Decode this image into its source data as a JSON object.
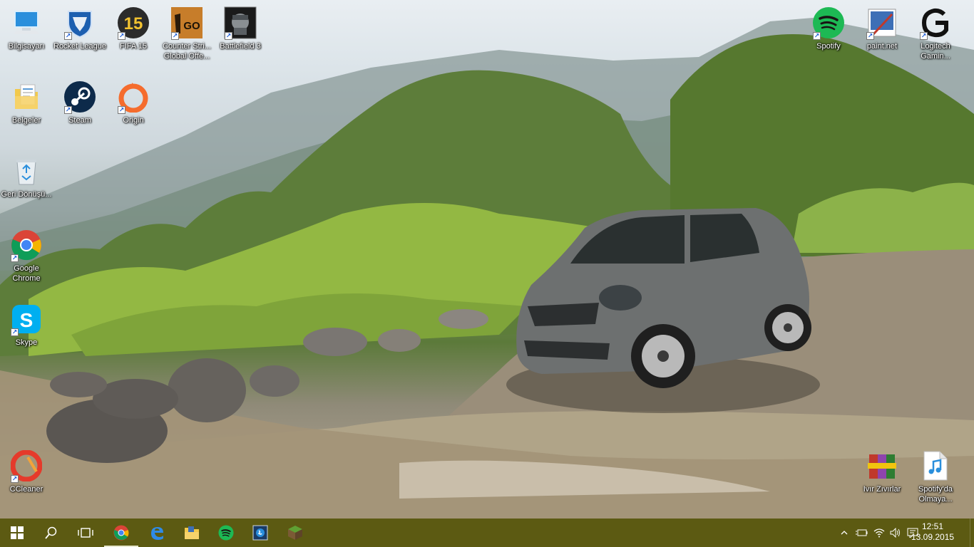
{
  "desktop": {
    "icons": [
      {
        "label": "Bilgisayarı",
        "icon": "computer-icon"
      },
      {
        "label": "Rocket League",
        "icon": "rocket-league-icon"
      },
      {
        "label": "FIFA 15",
        "icon": "fifa-15-icon"
      },
      {
        "label": "Counter Stri... Global Offe...",
        "icon": "csgo-icon"
      },
      {
        "label": "Battlefield 3",
        "icon": "battlefield-3-icon"
      },
      {
        "label": "Belgeler",
        "icon": "documents-folder-icon"
      },
      {
        "label": "Steam",
        "icon": "steam-icon"
      },
      {
        "label": "Origin",
        "icon": "origin-icon"
      },
      {
        "label": "Geri Dönüşü...",
        "icon": "recycle-bin-icon"
      },
      {
        "label": "Google Chrome",
        "icon": "chrome-icon"
      },
      {
        "label": "Skype",
        "icon": "skype-icon"
      },
      {
        "label": "CCleaner",
        "icon": "ccleaner-icon"
      },
      {
        "label": "Spotify",
        "icon": "spotify-icon"
      },
      {
        "label": "paint.net",
        "icon": "paintnet-icon"
      },
      {
        "label": "Logitech Gamin...",
        "icon": "logitech-gaming-icon"
      },
      {
        "label": "Ivır Zıvırlar",
        "icon": "winrar-archive-icon"
      },
      {
        "label": "Spotify'da Olmaya...",
        "icon": "music-file-icon"
      }
    ]
  },
  "taskbar": {
    "pinned": [
      "windows-start-icon",
      "search-icon",
      "task-view-icon",
      "chrome-icon",
      "edge-icon",
      "file-explorer-icon",
      "spotify-icon",
      "shazam-icon",
      "minecraft-icon"
    ],
    "tray": {
      "time": "12:51",
      "date": "13.09.2015"
    },
    "colors": {
      "taskbar": "#5c5a12"
    }
  }
}
